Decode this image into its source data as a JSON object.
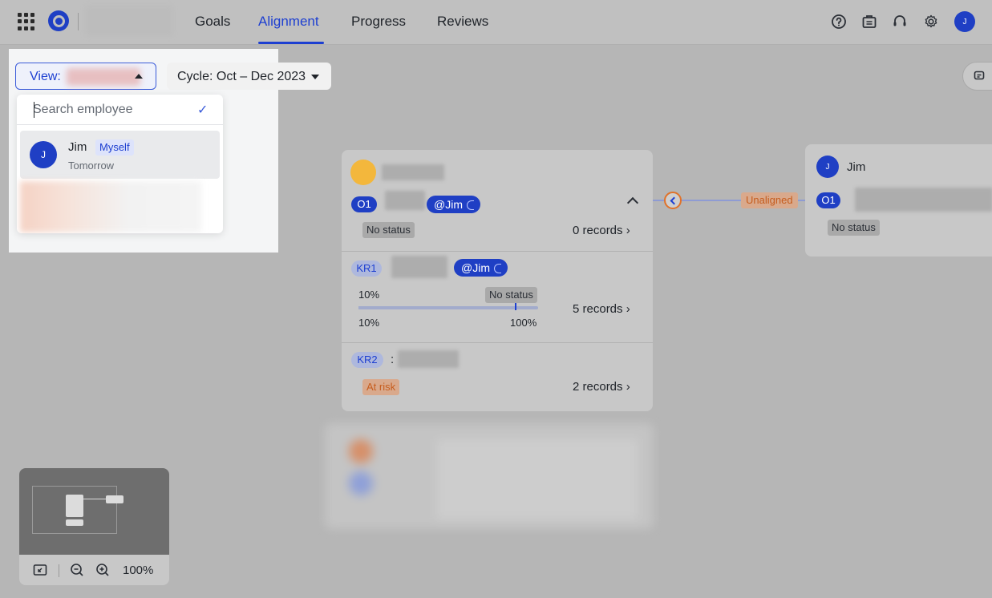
{
  "nav": {
    "tabs": [
      {
        "label": "Goals"
      },
      {
        "label": "Alignment"
      },
      {
        "label": "Progress"
      },
      {
        "label": "Reviews"
      }
    ],
    "active_tab": "Alignment",
    "avatar_initial": "J"
  },
  "toolbar": {
    "view_label": "View:",
    "cycle_label": "Cycle: Oct – Dec 2023"
  },
  "dropdown": {
    "search_placeholder": "Search employee",
    "items": [
      {
        "name": "Jim",
        "tag": "Myself",
        "sub": "Tomorrow",
        "initial": "J"
      }
    ],
    "check_glyph": "✓"
  },
  "objective_card": {
    "o1": {
      "label": "O1",
      "mention": "@Jim",
      "status": "No status",
      "records": "0 records"
    },
    "kr1": {
      "label": "KR1",
      "mention": "@Jim",
      "progress_start": "10%",
      "progress_label": "10%",
      "progress_end": "100%",
      "status": "No status",
      "records": "5 records",
      "progress_fraction": 0.1,
      "target_fraction": 0.87
    },
    "kr2": {
      "label": "KR2",
      "sep": ":",
      "status": "At risk",
      "records": "2 records"
    }
  },
  "connector": {
    "label": "Unaligned"
  },
  "aligned_card": {
    "owner": "Jim",
    "initial": "J",
    "o1_label": "O1",
    "status": "No status"
  },
  "minimap": {
    "zoom": "100%"
  },
  "colors": {
    "accent": "#1d3fd1",
    "brand": "#1f3fc4",
    "risk": "#c65d1e",
    "owner_dot": "#f3b73c"
  }
}
